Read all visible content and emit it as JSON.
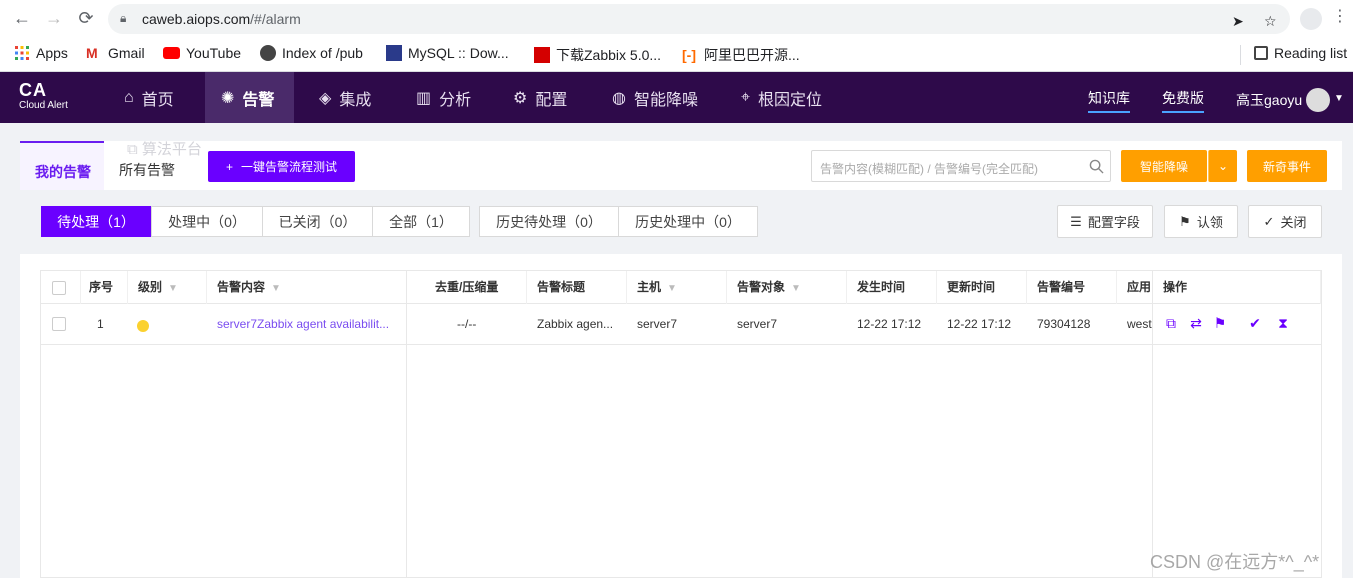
{
  "browser": {
    "url_host": "caweb.aiops.com",
    "url_path": "/#/alarm",
    "bookmarks": [
      "Apps",
      "Gmail",
      "YouTube",
      "Index of /pub",
      "MySQL :: Dow...",
      "下载Zabbix 5.0...",
      "阿里巴巴开源..."
    ],
    "reading_list": "Reading list"
  },
  "header": {
    "logo_main": "CA",
    "logo_sub": "Cloud Alert",
    "nav": [
      "首页",
      "告警",
      "集成",
      "分析",
      "配置",
      "智能降噪",
      "根因定位"
    ],
    "links": [
      "知识库",
      "免费版"
    ],
    "user": "高玉gaoyu"
  },
  "tabs": {
    "items": [
      "我的告警",
      "所有告警"
    ],
    "ghost": "算法平台",
    "test_button": "一键告警流程测试",
    "search_placeholder": "告警内容(模糊匹配) / 告警编号(完全匹配)",
    "smart_button": "智能降噪",
    "new_event_button": "新奇事件"
  },
  "filters": {
    "segments": [
      "待处理（1）",
      "处理中（0）",
      "已关闭（0）",
      "全部（1）"
    ],
    "history": [
      "历史待处理（0）",
      "历史处理中（0）"
    ],
    "config_fields": "配置字段",
    "claim": "认领",
    "close": "关闭"
  },
  "table": {
    "columns": [
      "序号",
      "级别",
      "告警内容",
      "去重/压缩量",
      "告警标题",
      "主机",
      "告警对象",
      "发生时间",
      "更新时间",
      "告警编号",
      "应用",
      "操作"
    ],
    "rows": [
      {
        "index": "1",
        "level": "warning",
        "content": "server7Zabbix agent availabilit...",
        "dedup": "--/--",
        "title": "Zabbix agen...",
        "host": "server7",
        "object": "server7",
        "occur_time": "12-22 17:12",
        "update_time": "12-22 17:12",
        "alarm_no": "79304128",
        "app": "west"
      }
    ],
    "colors": {
      "level_dot": "#fbd12f",
      "accent": "#6a00ff",
      "header_bg": "#2e0a4a",
      "orange": "#ff9f00"
    }
  },
  "watermark": "CSDN @在远方*^_^*"
}
